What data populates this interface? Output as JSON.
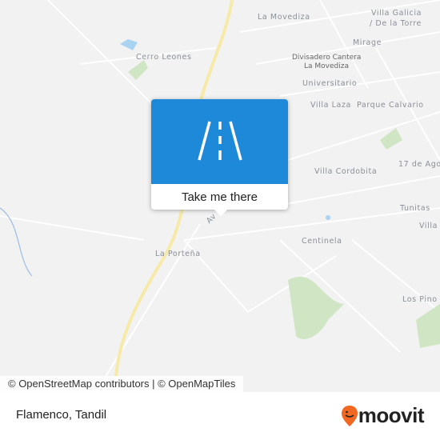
{
  "map": {
    "labels": {
      "la_movediza": "La Movediza",
      "villa_galicia": "Villa Galicia",
      "de_la_torre": "/ De la Torre",
      "mirage": "Mirage",
      "divisadero_1": "Divisadero Cantera",
      "divisadero_2": "La Movediza",
      "cerro_leones": "Cerro Leones",
      "universitario": "Universitario",
      "villa_laza": "Villa Laza",
      "parque_calvario": "Parque Calvario",
      "villa_cordobita": "Villa Cordobita",
      "diecisiete": "17 de Ago",
      "tunitas": "Tunitas",
      "villa": "Villa",
      "centinela": "Centinela",
      "la_portena": "La Porteña",
      "los_pinos": "Los Pino",
      "av": "Av"
    }
  },
  "popup": {
    "icon": "road-icon",
    "cta": "Take me there",
    "color": "#1e88d9"
  },
  "attribution": "© OpenStreetMap contributors | © OpenMapTiles",
  "footer": {
    "place": "Flamenco, Tandil",
    "logo_text": "moovit",
    "logo_color": "#f26722"
  }
}
